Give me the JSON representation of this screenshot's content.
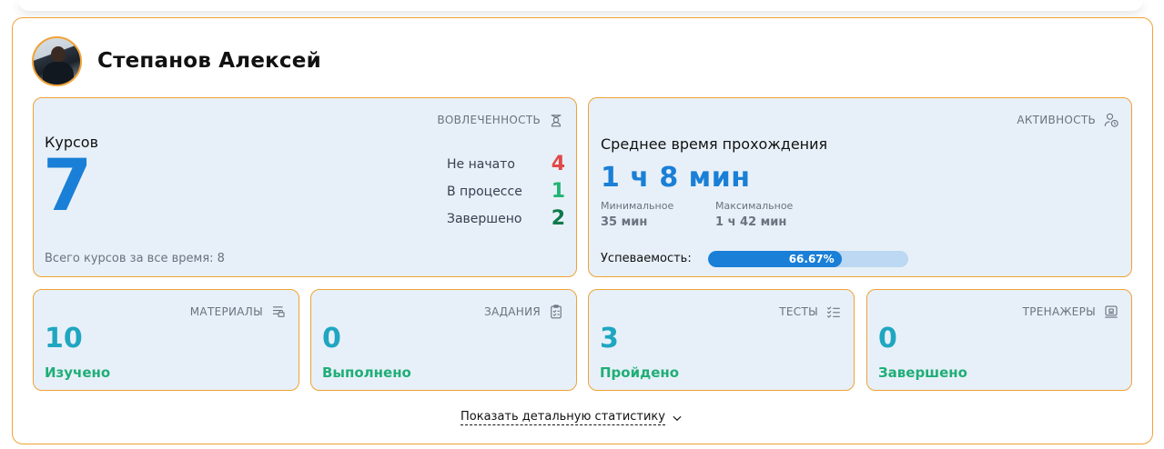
{
  "user": {
    "name": "Степанов Алексей"
  },
  "engagement": {
    "label": "ВОВЛЕЧЕННОСТЬ",
    "icon": "graduate-icon",
    "courses_label": "Курсов",
    "courses_count": "7",
    "rows": [
      {
        "label": "Не начато",
        "value": "4",
        "color": "#e04848"
      },
      {
        "label": "В процессе",
        "value": "1",
        "color": "#22b573"
      },
      {
        "label": "Завершено",
        "value": "2",
        "color": "#0e7a4b"
      }
    ],
    "total": "Всего курсов за все время: 8"
  },
  "activity": {
    "label": "АКТИВНОСТЬ",
    "icon": "user-clock-icon",
    "title": "Среднее время прохождения",
    "average": "1 ч 8 мин",
    "min_label": "Минимальное",
    "min_value": "35 мин",
    "max_label": "Максимальное",
    "max_value": "1 ч 42 мин",
    "performance_label": "Успеваемость:",
    "performance_value": "66.67%",
    "performance_fraction": 0.6667
  },
  "tiles": [
    {
      "label": "МАТЕРИАЛЫ",
      "icon": "materials-icon",
      "value": "10",
      "status": "Изучено"
    },
    {
      "label": "ЗАДАНИЯ",
      "icon": "clipboard-icon",
      "value": "0",
      "status": "Выполнено"
    },
    {
      "label": "ТЕСТЫ",
      "icon": "checklist-icon",
      "value": "3",
      "status": "Пройдено"
    },
    {
      "label": "ТРЕНАЖЕРЫ",
      "icon": "monitor-icon",
      "value": "0",
      "status": "Завершено"
    }
  ],
  "show_details": {
    "label": "Показать детальную статистику",
    "icon": "chevron-down-icon"
  },
  "colors": {
    "accent_border": "#f0a236",
    "primary_blue": "#1a7fd6",
    "teal": "#1fa6c1",
    "green": "#1fae77",
    "tile_bg": "#e7f0f8"
  }
}
